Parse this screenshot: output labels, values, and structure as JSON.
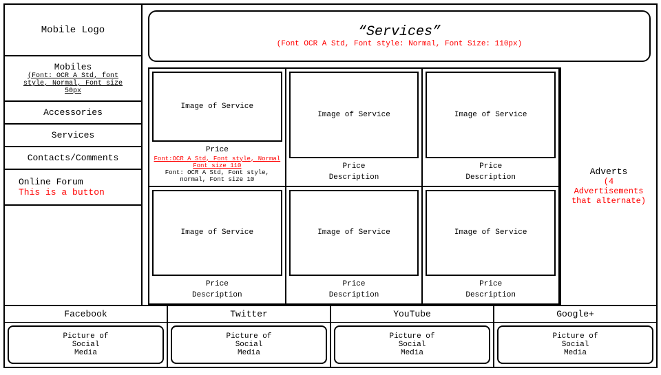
{
  "sidebar": {
    "logo_label": "Mobile Logo",
    "nav_items": [
      {
        "id": "mobiles",
        "label": "Mobiles",
        "sublabel": "(Font: OCR A Std, font style, Normal, Font size 50px"
      },
      {
        "id": "accessories",
        "label": "Accessories"
      },
      {
        "id": "services",
        "label": "Services"
      },
      {
        "id": "contacts",
        "label": "Contacts/Comments"
      },
      {
        "id": "online-forum",
        "label": "Online Forum",
        "button": "This is a button"
      }
    ]
  },
  "header": {
    "title": "“Services”",
    "subtitle": "(Font OCR A Std, Font style: Normal, Font Size: 110px)"
  },
  "products": {
    "row1": [
      {
        "image": "Image of Service",
        "price": "Price",
        "price_note": "Font:OCR A Std, Font style, Normal",
        "price_note2": "Font size 110",
        "desc_note": "Font: OCR A Std, Font style, normal, Font size 10"
      },
      {
        "image": "Image of Service",
        "price": "Price",
        "description": "Description"
      },
      {
        "image": "Image of Service",
        "price": "Price",
        "description": "Description"
      }
    ],
    "row2": [
      {
        "image": "Image of Service",
        "price": "Price",
        "description": "Description"
      },
      {
        "image": "Image of Service",
        "price": "Price",
        "description": "Description"
      },
      {
        "image": "Image of Service",
        "price": "Price",
        "description": "Description"
      }
    ]
  },
  "adverts": {
    "label": "Adverts",
    "sublabel": "(4 Advertisements that alternate)"
  },
  "social": [
    {
      "id": "facebook",
      "label": "Facebook",
      "image": "Picture of\nSocial\nMedia"
    },
    {
      "id": "twitter",
      "label": "Twitter",
      "image": "Picture of\nSocial\nMedia"
    },
    {
      "id": "youtube",
      "label": "YouTube",
      "image": "Picture of\nSocial\nMedia"
    },
    {
      "id": "googleplus",
      "label": "Google+",
      "image": "Picture of\nSocial\nMedia"
    }
  ]
}
